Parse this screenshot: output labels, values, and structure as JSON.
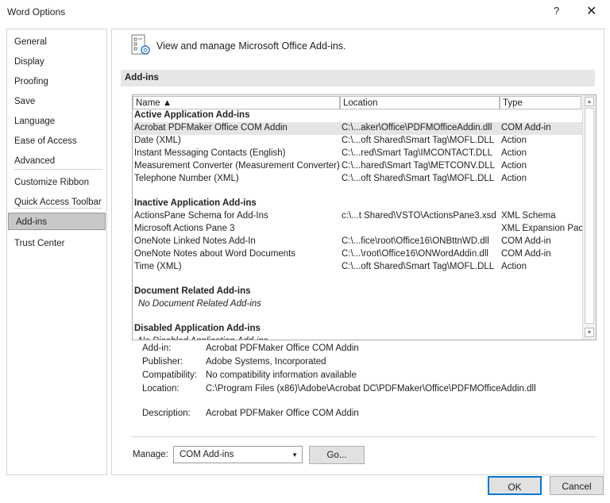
{
  "window": {
    "title": "Word Options",
    "help": "?",
    "close": "✕"
  },
  "sidebar": {
    "items": [
      {
        "label": "General"
      },
      {
        "label": "Display"
      },
      {
        "label": "Proofing"
      },
      {
        "label": "Save"
      },
      {
        "label": "Language"
      },
      {
        "label": "Ease of Access"
      },
      {
        "label": "Advanced"
      },
      {
        "label": "Customize Ribbon"
      },
      {
        "label": "Quick Access Toolbar"
      },
      {
        "label": "Add-ins",
        "selected": true
      },
      {
        "label": "Trust Center"
      }
    ]
  },
  "header": {
    "text": "View and manage Microsoft Office Add-ins.",
    "icon": "addins-gear-icon"
  },
  "section": {
    "title": "Add-ins"
  },
  "list": {
    "columns": [
      "Name ▲",
      "Location",
      "Type"
    ],
    "groups": [
      {
        "title": "Active Application Add-ins",
        "rows": [
          [
            "Acrobat PDFMaker Office COM Addin",
            "C:\\...aker\\Office\\PDFMOfficeAddin.dll",
            "COM Add-in"
          ],
          [
            "Date (XML)",
            "C:\\...oft Shared\\Smart Tag\\MOFL.DLL",
            "Action"
          ],
          [
            "Instant Messaging Contacts (English)",
            "C:\\...red\\Smart Tag\\IMCONTACT.DLL",
            "Action"
          ],
          [
            "Measurement Converter (Measurement Converter)",
            "C:\\...hared\\Smart Tag\\METCONV.DLL",
            "Action"
          ],
          [
            "Telephone Number (XML)",
            "C:\\...oft Shared\\Smart Tag\\MOFL.DLL",
            "Action"
          ]
        ]
      },
      {
        "title": "Inactive Application Add-ins",
        "rows": [
          [
            "ActionsPane Schema for Add-Ins",
            "c:\\...t Shared\\VSTO\\ActionsPane3.xsd",
            "XML Schema"
          ],
          [
            "Microsoft Actions Pane 3",
            "",
            "XML Expansion Pack"
          ],
          [
            "OneNote Linked Notes Add-In",
            "C:\\...fice\\root\\Office16\\ONBttnWD.dll",
            "COM Add-in"
          ],
          [
            "OneNote Notes about Word Documents",
            "C:\\...\\root\\Office16\\ONWordAddin.dll",
            "COM Add-in"
          ],
          [
            "Time (XML)",
            "C:\\...oft Shared\\Smart Tag\\MOFL.DLL",
            "Action"
          ]
        ]
      },
      {
        "title": "Document Related Add-ins",
        "empty": "No Document Related Add-ins"
      },
      {
        "title": "Disabled Application Add-ins",
        "empty": "No Disabled Application Add-ins"
      }
    ]
  },
  "details": [
    {
      "label": "Add-in:",
      "value": "Acrobat PDFMaker Office COM Addin"
    },
    {
      "label": "Publisher:",
      "value": "Adobe Systems, Incorporated"
    },
    {
      "label": "Compatibility:",
      "value": "No compatibility information available"
    },
    {
      "label": "Location:",
      "value": "C:\\Program Files (x86)\\Adobe\\Acrobat DC\\PDFMaker\\Office\\PDFMOfficeAddin.dll"
    },
    {
      "label": "Description:",
      "value": "Acrobat PDFMaker Office COM Addin"
    }
  ],
  "manage": {
    "label": "Manage:",
    "value": "COM Add-ins",
    "go": "Go..."
  },
  "buttons": {
    "ok": "OK",
    "cancel": "Cancel"
  }
}
